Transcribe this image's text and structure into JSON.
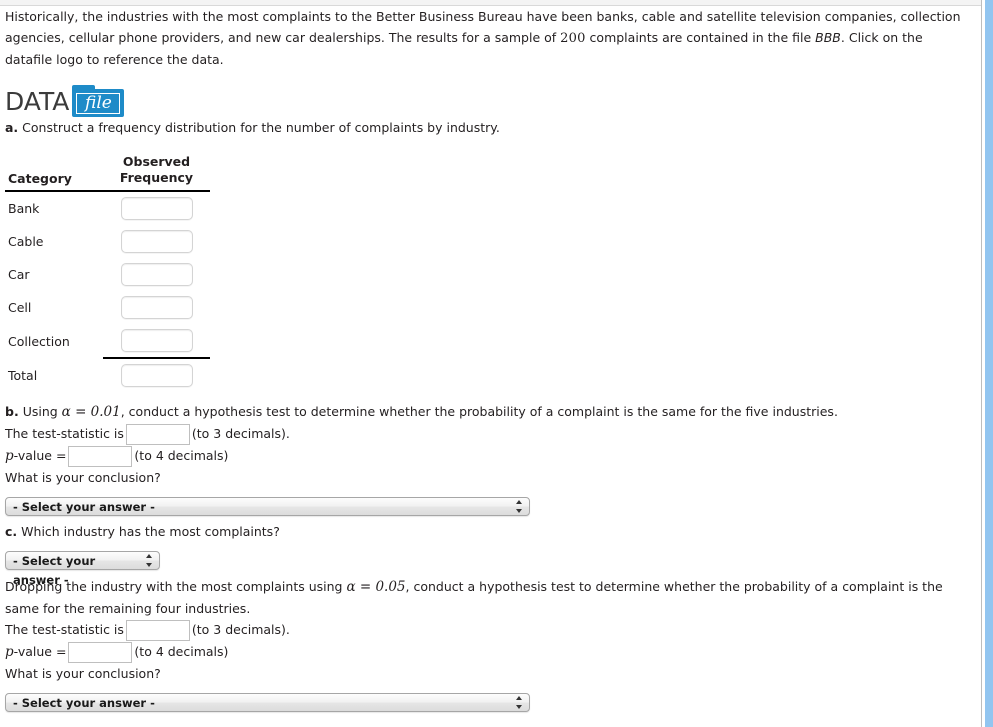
{
  "intro": {
    "text_part1": "Historically, the industries with the most complaints to the Better Business Bureau have been banks, cable and satellite television companies, collection agencies, cellular phone providers, and new car dealerships. The results for a sample of ",
    "sample_size": "200",
    "text_part2": " complaints are contained in the file ",
    "file_name": "BBB",
    "text_part3": ". Click on the datafile logo to reference the data."
  },
  "datafile_logo": {
    "word_data": "DATA",
    "word_file": "file",
    "icon": "folder-icon",
    "color": "#1e8bc8"
  },
  "part_a": {
    "label": "a.",
    "text": "Construct a frequency distribution for the number of complaints by industry.",
    "table": {
      "headers": {
        "category": "Category",
        "frequency_line1": "Observed",
        "frequency_line2": "Frequency"
      },
      "rows": [
        {
          "category": "Bank",
          "value": ""
        },
        {
          "category": "Cable",
          "value": ""
        },
        {
          "category": "Car",
          "value": ""
        },
        {
          "category": "Cell",
          "value": ""
        },
        {
          "category": "Collection",
          "value": ""
        }
      ],
      "total_row": {
        "category": "Total",
        "value": ""
      }
    }
  },
  "part_b": {
    "label": "b.",
    "text_before_alpha": "Using ",
    "alpha_expr": "α = 0.01",
    "text_after_alpha": ", conduct a hypothesis test to determine whether the probability of a complaint is the same for the five industries.",
    "test_statistic_label": "The test-statistic is",
    "test_statistic_value": "",
    "test_statistic_hint": "(to 3 decimals).",
    "p_value_symbol": "p",
    "p_value_label": "-value =",
    "p_value_value": "",
    "p_value_hint": "(to 4 decimals)",
    "conclusion_prompt": "What is your conclusion?",
    "conclusion_select": "- Select your answer -"
  },
  "part_c": {
    "label": "c.",
    "text": "Which industry has the most complaints?",
    "industry_select": "- Select your answer -",
    "drop_text_before_alpha": "Dropping the industry with the most complaints using ",
    "drop_alpha_expr": "α = 0.05",
    "drop_text_after_alpha": ", conduct a hypothesis test to determine whether the probability of a complaint is the same for the remaining four industries.",
    "test_statistic_label": "The test-statistic is",
    "test_statistic_value": "",
    "test_statistic_hint": "(to 3 decimals).",
    "p_value_symbol": "p",
    "p_value_label": "-value =",
    "p_value_value": "",
    "p_value_hint": "(to 4 decimals)",
    "conclusion_prompt": "What is your conclusion?",
    "conclusion_select": "- Select your answer -"
  }
}
